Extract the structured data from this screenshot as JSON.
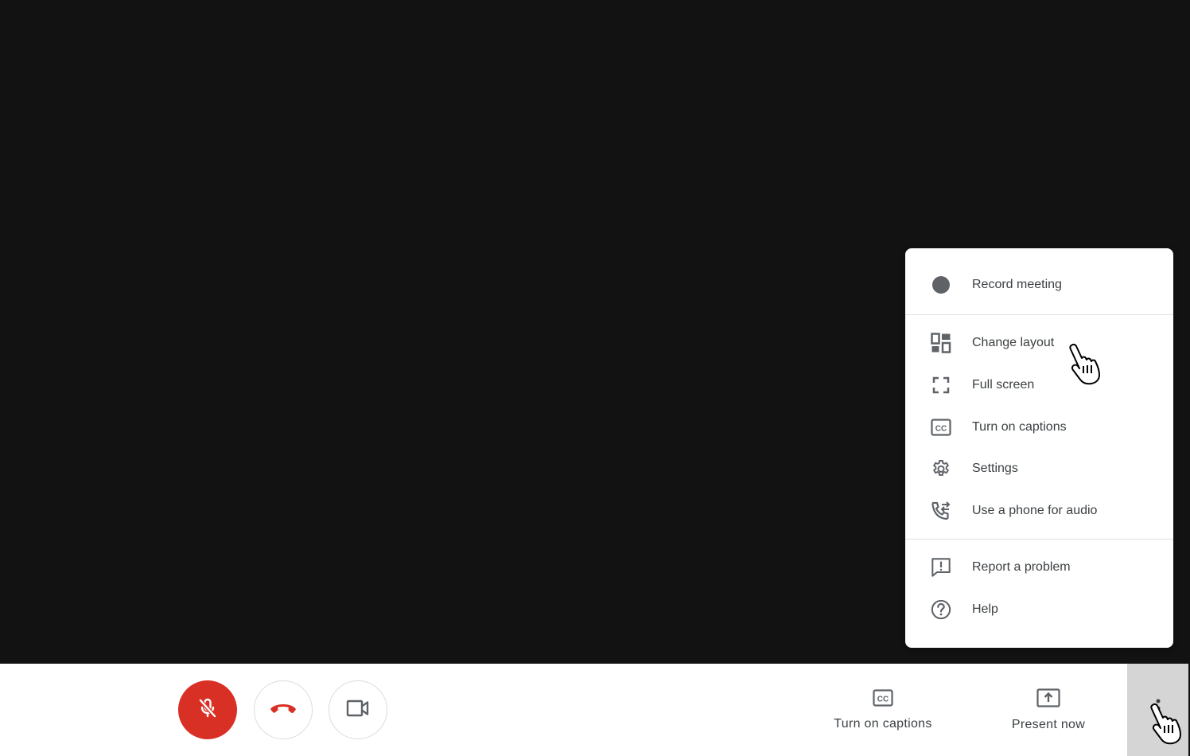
{
  "menu": {
    "items": [
      {
        "label": "Record meeting",
        "icon": "record-dot-icon"
      },
      {
        "label": "Change layout",
        "icon": "layout-icon"
      },
      {
        "label": "Full screen",
        "icon": "fullscreen-icon"
      },
      {
        "label": "Turn on captions",
        "icon": "captions-icon"
      },
      {
        "label": "Settings",
        "icon": "gear-icon"
      },
      {
        "label": "Use a phone for audio",
        "icon": "phone-audio-icon"
      },
      {
        "label": "Report a problem",
        "icon": "report-problem-icon"
      },
      {
        "label": "Help",
        "icon": "help-icon"
      }
    ]
  },
  "toolbar": {
    "mic": {
      "icon": "mic-off-icon",
      "state": "muted"
    },
    "hangup": {
      "icon": "hangup-icon"
    },
    "camera": {
      "icon": "camera-icon"
    },
    "captions": {
      "label": "Turn on captions",
      "icon": "captions-icon"
    },
    "present": {
      "label": "Present now",
      "icon": "present-icon"
    },
    "more": {
      "icon": "more-options-icon"
    }
  },
  "colors": {
    "stage_bg": "#121212",
    "mic_muted_bg": "#d93025",
    "hangup_red": "#d93025",
    "icon_gray": "#5f6368",
    "text": "#3c4043",
    "more_active_bg": "#d5d5d5"
  }
}
